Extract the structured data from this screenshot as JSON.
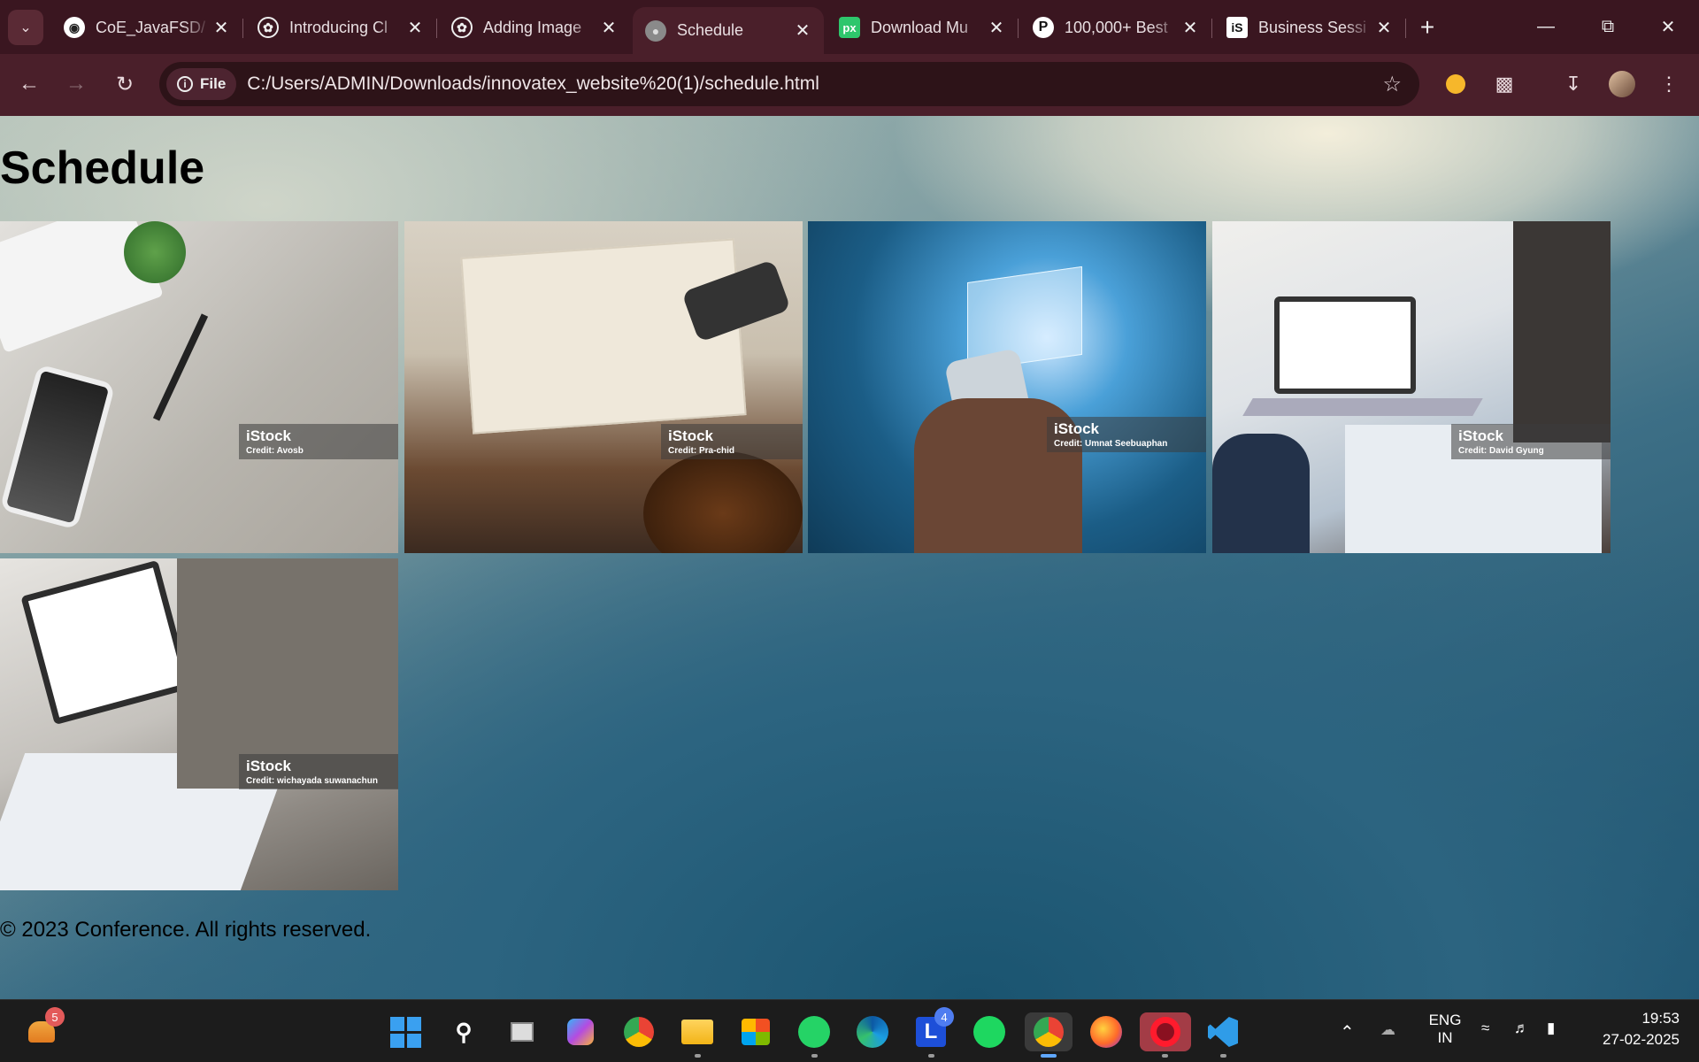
{
  "browser": {
    "tabs": [
      {
        "title": "CoE_JavaFSD/",
        "favicon": "github-icon"
      },
      {
        "title": "Introducing Cl",
        "favicon": "openai-icon"
      },
      {
        "title": "Adding Image",
        "favicon": "openai-icon"
      },
      {
        "title": "Schedule",
        "favicon": "globe-icon",
        "active": true
      },
      {
        "title": "Download Mu",
        "favicon": "pixabay-icon"
      },
      {
        "title": "100,000+ Best",
        "favicon": "pexels-icon"
      },
      {
        "title": "Business Sessi",
        "favicon": "istock-icon"
      }
    ],
    "file_chip": "File",
    "url": "C:/Users/ADMIN/Downloads/innovatex_website%20(1)/schedule.html"
  },
  "page": {
    "title": "Schedule",
    "images": [
      {
        "brand": "iStock",
        "credit": "Credit: Avosb"
      },
      {
        "brand": "iStock",
        "credit": "Credit: Pra-chid"
      },
      {
        "brand": "iStock",
        "credit": "Credit: Umnat Seebuaphan"
      },
      {
        "brand": "iStock",
        "credit": "Credit: David Gyung"
      },
      {
        "brand": "iStock",
        "credit": "Credit: wichayada suwanachun"
      }
    ],
    "footer": "© 2023 Conference. All rights reserved."
  },
  "taskbar": {
    "widgets_badge": "5",
    "taskbar_l_badge": "4",
    "lang_top": "ENG",
    "lang_bottom": "IN",
    "time": "19:53",
    "date": "27-02-2025"
  }
}
